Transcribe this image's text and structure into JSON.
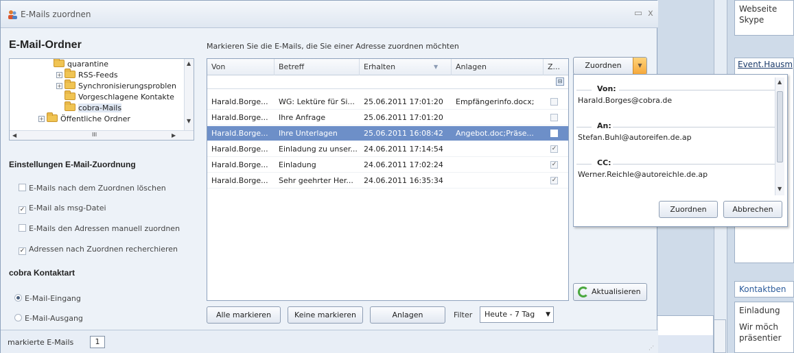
{
  "window": {
    "title": "E-Mails zuordnen",
    "minimize_glyph": "▭",
    "close_glyph": "x"
  },
  "left": {
    "folders_heading": "E-Mail-Ordner",
    "tree": [
      {
        "label": "quarantine",
        "expand": ""
      },
      {
        "label": "RSS-Feeds",
        "expand": "+"
      },
      {
        "label": "Synchronisierungsproblen",
        "expand": "+"
      },
      {
        "label": "Vorgeschlagene Kontakte",
        "expand": ""
      },
      {
        "label": "cobra-Mails",
        "expand": ""
      },
      {
        "label": "Öffentliche Ordner",
        "expand": "+"
      }
    ],
    "tree_hscroll_glyph": "III",
    "settings_heading": "Einstellungen E-Mail-Zuordnung",
    "options": [
      {
        "label": "E-Mails nach dem Zuordnen löschen",
        "checked": ""
      },
      {
        "label": "E-Mail als msg-Datei",
        "checked": "✓"
      },
      {
        "label": "E-Mails den Adressen manuell zuordnen",
        "checked": ""
      },
      {
        "label": "Adressen nach Zuordnen recherchieren",
        "checked": "✓"
      }
    ],
    "kontakt_heading": "cobra Kontaktart",
    "radios": [
      {
        "label": "E-Mail-Eingang",
        "selected": true
      },
      {
        "label": "E-Mail-Ausgang",
        "selected": false
      }
    ]
  },
  "center": {
    "instruction": "Markieren Sie die E-Mails, die Sie einer Adresse zuordnen möchten",
    "columns": [
      "Von",
      "Betreff",
      "Erhalten",
      "Anlagen",
      "Z..."
    ],
    "sort_glyph": "▼",
    "rows": [
      {
        "von": "Harald.Borge...",
        "betreff": "WG: Lektüre für Si...",
        "erhalten": "25.06.2011 17:01:20",
        "anlagen": "Empfängerinfo.docx;",
        "z": ""
      },
      {
        "von": "Harald.Borge...",
        "betreff": "Ihre Anfrage",
        "erhalten": "25.06.2011 17:01:20",
        "anlagen": "",
        "z": ""
      },
      {
        "von": "Harald.Borge...",
        "betreff": "Ihre Unterlagen",
        "erhalten": "25.06.2011 16:08:42",
        "anlagen": "Angebot.doc;Präse...",
        "z": ""
      },
      {
        "von": "Harald.Borge...",
        "betreff": "Einladung zu unser...",
        "erhalten": "24.06.2011 17:14:54",
        "anlagen": "",
        "z": "✓"
      },
      {
        "von": "Harald.Borge...",
        "betreff": "Einladung",
        "erhalten": "24.06.2011 17:02:24",
        "anlagen": "",
        "z": "✓"
      },
      {
        "von": "Harald.Borge...",
        "betreff": "Sehr geehrter Her...",
        "erhalten": "24.06.2011 16:35:34",
        "anlagen": "",
        "z": "✓"
      }
    ],
    "buttons": {
      "mark_all": "Alle markieren",
      "mark_none": "Keine markieren",
      "attachments": "Anlagen"
    },
    "filter_label": "Filter",
    "filter_value": "Heute - 7 Tag"
  },
  "right": {
    "assign_label": "Zuordnen",
    "popup": {
      "sections": [
        {
          "label": "Von:",
          "value": "Harald.Borges@cobra.de"
        },
        {
          "label": "An:",
          "value": "Stefan.Buhl@autoreifen.de.ap"
        },
        {
          "label": "CC:",
          "value": "Werner.Reichle@autoreichle.de.ap"
        }
      ],
      "ok_label": "Zuordnen",
      "cancel_label": "Abbrechen"
    },
    "refresh_label": "Aktualisieren"
  },
  "status": {
    "label": "markierte E-Mails",
    "count": "1"
  },
  "background": {
    "top_lines": [
      "Webseite",
      "Skype"
    ],
    "event_link": "Event.Hausm",
    "kontakt_title": "Kontaktben",
    "kontakt_lines": [
      "Einladung",
      "Wir möch",
      "präsentier"
    ]
  }
}
